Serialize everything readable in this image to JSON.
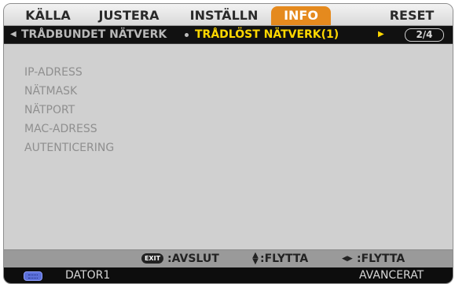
{
  "tabs": [
    {
      "label": "KÄLLA"
    },
    {
      "label": "JUSTERA"
    },
    {
      "label": "INSTÄLLN"
    },
    {
      "label": "INFO"
    },
    {
      "label": "RESET"
    }
  ],
  "subnav": {
    "left_arrow": "◀",
    "inactive_label": "TRÅDBUNDET NÄTVERK",
    "active_label": "TRÅDLÖST NÄTVERK(1)",
    "right_arrow": "▶",
    "page": "2/4"
  },
  "items": [
    {
      "label": "IP-ADRESS"
    },
    {
      "label": "NÄTMASK"
    },
    {
      "label": "NÄTPORT"
    },
    {
      "label": "MAC-ADRESS"
    },
    {
      "label": "AUTENTICERING"
    }
  ],
  "hints": {
    "exit_key": "EXIT",
    "exit_label": ":AVSLUT",
    "move_label_1": ":FLYTTA",
    "move_label_2": ":FLYTTA"
  },
  "status": {
    "source": "DATOR1",
    "mode": "AVANCERAT"
  },
  "colors": {
    "accent": "#e58a1e",
    "active_sub": "#ffd800"
  }
}
